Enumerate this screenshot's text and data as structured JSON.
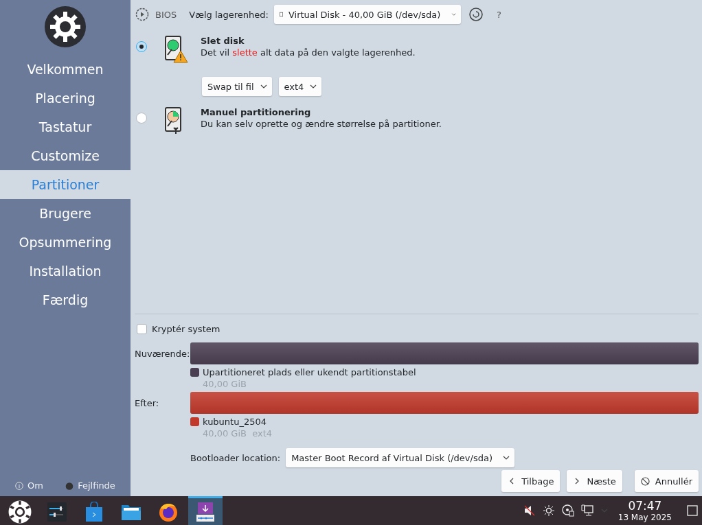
{
  "sidebar": {
    "items": [
      {
        "label": "Velkommen",
        "selected": false
      },
      {
        "label": "Placering",
        "selected": false
      },
      {
        "label": "Tastatur",
        "selected": false
      },
      {
        "label": "Customize",
        "selected": false
      },
      {
        "label": "Partitioner",
        "selected": true
      },
      {
        "label": "Brugere",
        "selected": false
      },
      {
        "label": "Opsummering",
        "selected": false
      },
      {
        "label": "Installation",
        "selected": false
      },
      {
        "label": "Færdig",
        "selected": false
      }
    ],
    "footer": [
      {
        "kind": "about",
        "label": "Om"
      },
      {
        "kind": "debug",
        "label": "Fejlfinde"
      }
    ]
  },
  "toolbar": {
    "firmware": "BIOS",
    "storage_label": "Vælg lagerenhed:",
    "storage_value": "Virtual Disk - 40,00 GiB (/dev/sda)",
    "help": "?"
  },
  "options": [
    {
      "kind": "erase",
      "selected": true,
      "title": "Slet disk",
      "description": [
        {
          "kind": "normal",
          "text": "Det vil "
        },
        {
          "kind": "warning",
          "text": "slette"
        },
        {
          "kind": "normal",
          "text": " alt data på den valgte lagerenhed."
        }
      ],
      "dropdowns": [
        "Swap til fil",
        "ext4"
      ]
    },
    {
      "kind": "manual",
      "selected": false,
      "title": "Manuel partitionering",
      "description": [
        {
          "kind": "normal",
          "text": "Du kan selv oprette og ændre størrelse på partitioner."
        }
      ]
    }
  ],
  "encrypt": {
    "label": "Kryptér system",
    "checked": false
  },
  "layouts": [
    {
      "label": "Nuværende:",
      "partitions": [
        {
          "name": "Upartitioneret plads eller ukendt partitionstabel",
          "details": "40,00 GiB",
          "color": "#4a3f52"
        }
      ]
    },
    {
      "label": "Efter:",
      "partitions": [
        {
          "name": "kubuntu_2504",
          "details": "40,00 GiB  ext4",
          "color": "#c0392b"
        }
      ]
    }
  ],
  "bootloader": {
    "label": "Bootloader location:",
    "value": "Master Boot Record af Virtual Disk (/dev/sda)"
  },
  "buttons": [
    {
      "kind": "back",
      "label": "Tilbage"
    },
    {
      "kind": "next",
      "label": "Næste"
    },
    {
      "kind": "cancel",
      "label": "Annullér"
    }
  ],
  "taskbar": {
    "apps": [
      {
        "kind": "settings",
        "selected": false
      },
      {
        "kind": "store",
        "selected": false
      },
      {
        "kind": "files",
        "selected": false
      },
      {
        "kind": "browser",
        "selected": false
      },
      {
        "kind": "installer",
        "selected": true
      }
    ],
    "time": "07:47",
    "date": "13 May 2025"
  }
}
